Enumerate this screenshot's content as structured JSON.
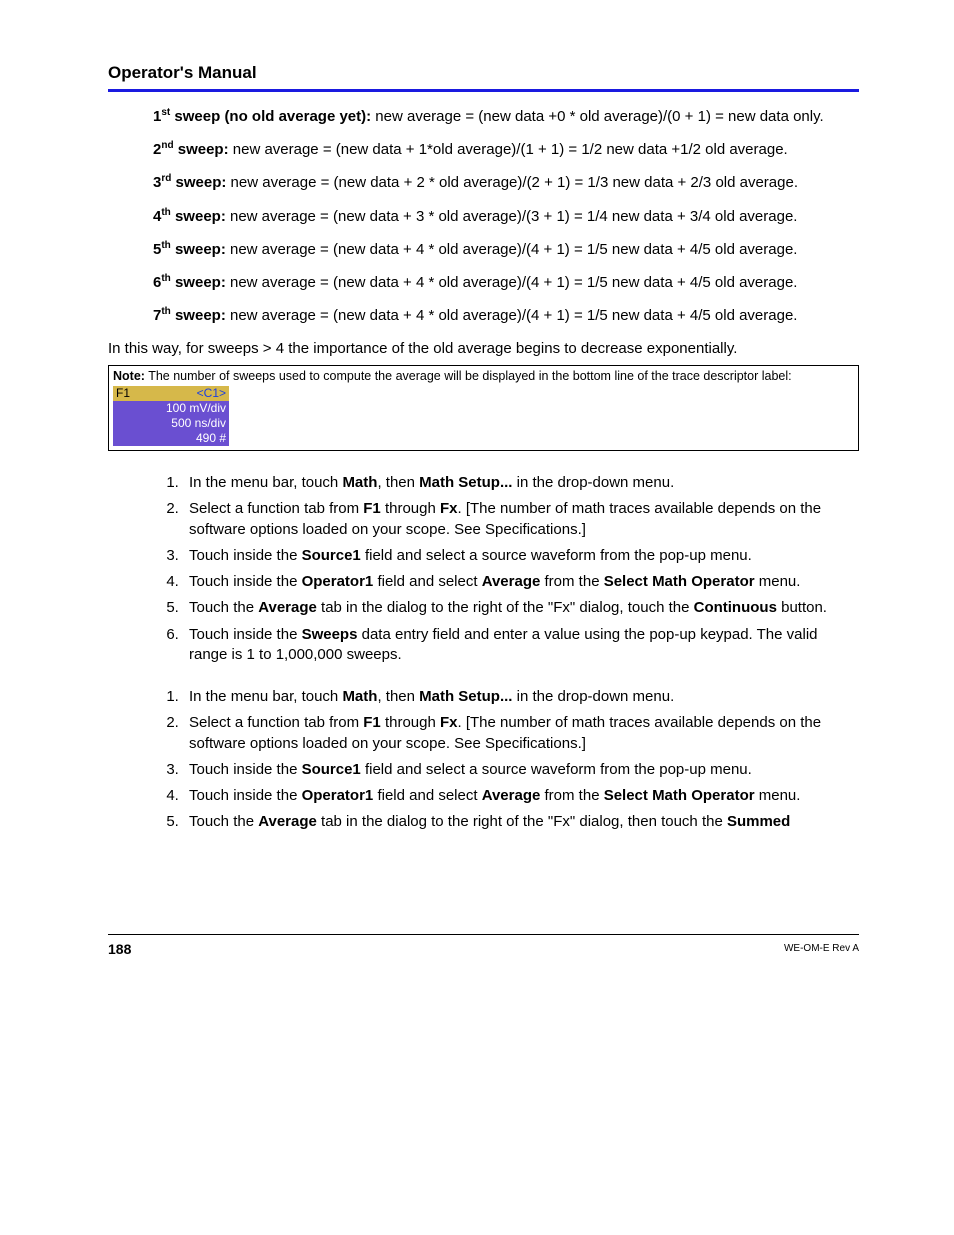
{
  "header": {
    "title": "Operator's Manual"
  },
  "sweeps": [
    {
      "ord": "1",
      "sup": "st",
      "label": " sweep (no old average yet):",
      "rest": " new average =  (new data +0 * old average)/(0 + 1) = new data only."
    },
    {
      "ord": "2",
      "sup": "nd",
      "label": " sweep:",
      "rest": " new average = (new data + 1*old average)/(1 + 1) = 1/2 new data +1/2 old average."
    },
    {
      "ord": "3",
      "sup": "rd",
      "label": " sweep:",
      "rest": " new average = (new data + 2 * old average)/(2 + 1) = 1/3 new data + 2/3 old average."
    },
    {
      "ord": "4",
      "sup": "th",
      "label": " sweep:",
      "rest": " new average = (new data + 3 * old average)/(3 + 1) = 1/4 new data + 3/4 old average."
    },
    {
      "ord": "5",
      "sup": "th",
      "label": " sweep:",
      "rest": " new average = (new data + 4 * old average)/(4 + 1) = 1/5 new data + 4/5 old average."
    },
    {
      "ord": "6",
      "sup": "th",
      "label": " sweep:",
      "rest": " new average = (new data + 4 * old average)/(4 + 1) = 1/5 new data + 4/5 old average."
    },
    {
      "ord": "7",
      "sup": "th",
      "label": " sweep:",
      "rest": " new average = (new data + 4 * old average)/(4 + 1) = 1/5 new data + 4/5 old average."
    }
  ],
  "intro_body": "In this way, for sweeps > 4 the importance of the old average begins to decrease exponentially.",
  "note": {
    "label": "Note:",
    "text": " The number of sweeps used to compute the average will be displayed in the bottom line of the trace descriptor label:",
    "trace": {
      "f1": "F1",
      "c1": "<C1>",
      "line1": "100 mV/div",
      "line2": "500 ns/div",
      "line3": "490 #"
    }
  },
  "steps_a": [
    {
      "pre": "In the menu bar, touch ",
      "b1": "Math",
      "mid": ", then ",
      "b2": "Math Setup...",
      "post": " in the drop-down menu."
    },
    {
      "pre": "Select a function tab from ",
      "b1": "F1",
      "mid": " through ",
      "b2": "Fx",
      "post": ". [The number of math traces available depends on the software options loaded on your scope. See Specifications.]"
    },
    {
      "pre": "Touch inside the ",
      "b1": "Source1",
      "mid": "",
      "b2": "",
      "post": " field and select a source waveform from the pop-up menu."
    },
    {
      "pre": "Touch inside the ",
      "b1": "Operator1",
      "mid": " field and select ",
      "b2": "Average",
      "mid2": " from the ",
      "b3": "Select Math Operator",
      "post": " menu."
    },
    {
      "pre": "Touch the ",
      "b1": "Average",
      "mid": " tab in the dialog to the right of the \"Fx\" dialog, touch the ",
      "b2": "Continuous",
      "post": " button."
    },
    {
      "pre": "Touch inside the ",
      "b1": "Sweeps",
      "mid": "",
      "b2": "",
      "post": " data entry field and  enter a value using the pop-up keypad. The valid range is 1 to 1,000,000 sweeps."
    }
  ],
  "steps_b": [
    {
      "pre": "In the menu bar, touch ",
      "b1": "Math",
      "mid": ", then ",
      "b2": "Math Setup...",
      "post": " in the drop-down menu."
    },
    {
      "pre": "Select a function tab from ",
      "b1": "F1",
      "mid": " through ",
      "b2": "Fx",
      "post": ". [The number of math traces available depends on the software options loaded on your scope. See Specifications.]"
    },
    {
      "pre": "Touch inside the ",
      "b1": "Source1",
      "mid": "",
      "b2": "",
      "post": " field and select a source waveform from the pop-up menu."
    },
    {
      "pre": "Touch inside the ",
      "b1": "Operator1",
      "mid": " field and select ",
      "b2": "Average",
      "mid2": " from the ",
      "b3": "Select Math Operator",
      "post": " menu."
    },
    {
      "pre": "Touch the ",
      "b1": "Average",
      "mid": " tab in the dialog to the right of the \"Fx\" dialog, then touch the ",
      "b2": "Summed",
      "post": ""
    }
  ],
  "footer": {
    "page": "188",
    "rev": "WE-OM-E Rev A"
  }
}
